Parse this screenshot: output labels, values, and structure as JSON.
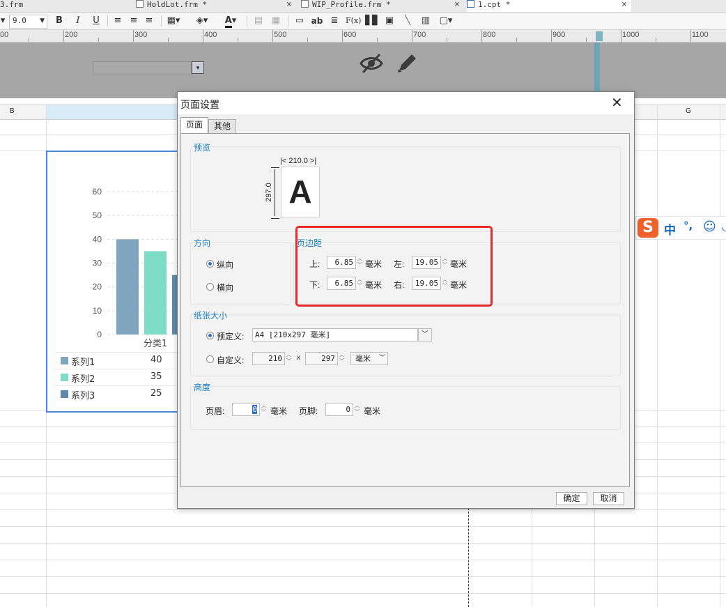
{
  "tabs": [
    {
      "label": "3.frm"
    },
    {
      "label": "HoldLot.frm *"
    },
    {
      "label": "WIP_Profile.frm *"
    },
    {
      "label": "1.cpt *"
    }
  ],
  "toolbar": {
    "font_size": "9.0",
    "bold": "B",
    "italic": "I",
    "underline": "U",
    "font_color": "A",
    "abbr_icon": "ab",
    "formula": "F(x)"
  },
  "ruler": {
    "labels": [
      "00",
      "200",
      "300",
      "400",
      "500",
      "600",
      "700",
      "800",
      "900",
      "1000",
      "1100"
    ]
  },
  "columns": {
    "b": "B",
    "g": "G"
  },
  "chart_data": {
    "type": "bar",
    "categories": [
      "分类1"
    ],
    "series": [
      {
        "name": "系列1",
        "values": [
          40
        ],
        "color": "#7fa4bd"
      },
      {
        "name": "系列2",
        "values": [
          35
        ],
        "color": "#7fdcc4"
      },
      {
        "name": "系列3",
        "values": [
          25
        ],
        "color": "#5f89ab"
      }
    ],
    "yticks": [
      "60",
      "50",
      "40",
      "30",
      "20",
      "10",
      "0"
    ],
    "ylim": [
      0,
      60
    ],
    "legend": "bottom-table",
    "grid": true
  },
  "dialog": {
    "title": "页面设置",
    "tab_page": "页面",
    "tab_other": "其他",
    "preview": {
      "label": "预览",
      "width": "210.0",
      "height": "297.0",
      "letter": "A"
    },
    "orientation": {
      "label": "方向",
      "portrait": "纵向",
      "landscape": "横向"
    },
    "margins": {
      "label": "页边距",
      "top_label": "上:",
      "top_value": "6.85",
      "bottom_label": "下:",
      "bottom_value": "6.85",
      "left_label": "左:",
      "left_value": "19.05",
      "right_label": "右:",
      "right_value": "19.05",
      "unit": "毫米"
    },
    "paper": {
      "label": "纸张大小",
      "predefined_label": "预定义:",
      "predefined_value": "A4 [210x297 毫米]",
      "custom_label": "自定义:",
      "custom_width": "210",
      "x": "x",
      "custom_height": "297",
      "unit": "毫米"
    },
    "height": {
      "label": "高度",
      "header_label": "页眉:",
      "header_value": "0",
      "footer_label": "页脚:",
      "footer_value": "0",
      "unit": "毫米"
    },
    "ok": "确定",
    "cancel": "取消"
  },
  "ime": {
    "chinese": "中",
    "punct": "°,"
  },
  "colors": {
    "highlight_box": "#e52b2b",
    "accent": "#1b7ec2",
    "chart_border": "#4a87d6"
  }
}
